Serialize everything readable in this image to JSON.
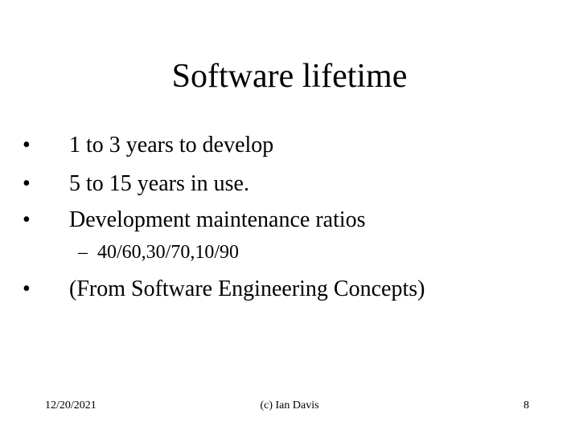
{
  "slide": {
    "title": "Software lifetime",
    "bullets": [
      {
        "marker": "•",
        "text": "1 to 3 years to develop"
      },
      {
        "marker": "•",
        "text": "5 to 15 years in use."
      },
      {
        "marker": "•",
        "text": "Development maintenance ratios"
      },
      {
        "marker": "•",
        "text": "(From Software Engineering Concepts)"
      }
    ],
    "sub_bullets": [
      {
        "marker": "–",
        "text": "40/60,30/70,10/90"
      }
    ]
  },
  "footer": {
    "date": "12/20/2021",
    "author": "(c) Ian Davis",
    "page_number": "8"
  }
}
